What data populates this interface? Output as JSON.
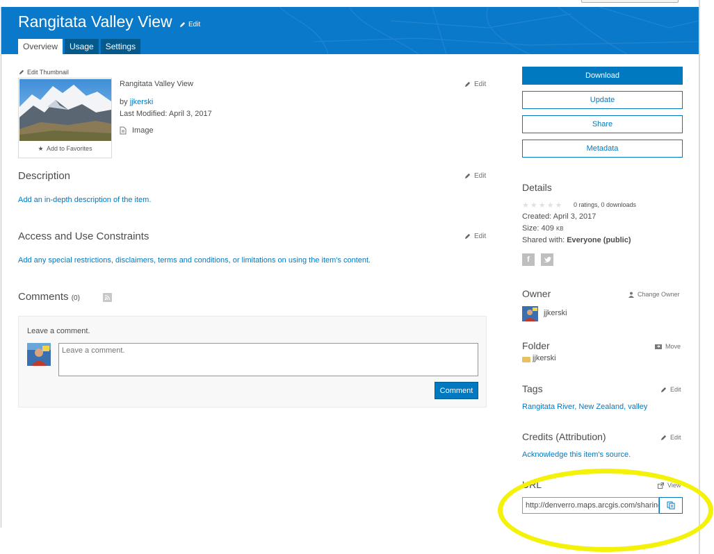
{
  "header": {
    "title": "Rangitata Valley View",
    "edit_label": "Edit",
    "tabs": [
      "Overview",
      "Usage",
      "Settings"
    ],
    "active_tab": "Overview",
    "color": "#0b79c9"
  },
  "item": {
    "edit_thumbnail": "Edit Thumbnail",
    "add_to_favorites": "Add to Favorites",
    "title": "Rangitata Valley View",
    "by_prefix": "by",
    "owner": "jjkerski",
    "last_modified": "Last Modified: April 3, 2017",
    "type": "Image",
    "edit_label": "Edit"
  },
  "description": {
    "heading": "Description",
    "edit_label": "Edit",
    "link": "Add an in-depth description of the item."
  },
  "access": {
    "heading": "Access and Use Constraints",
    "edit_label": "Edit",
    "link": "Add any special restrictions, disclaimers, terms and conditions, or limitations on using the item's content."
  },
  "comments": {
    "heading": "Comments",
    "count": "(0)",
    "leave_label": "Leave a comment.",
    "placeholder": "Leave a comment.",
    "button": "Comment"
  },
  "actions": {
    "download": "Download",
    "update": "Update",
    "share": "Share",
    "metadata": "Metadata"
  },
  "details": {
    "heading": "Details",
    "rating_stars": 0,
    "ratings": "0 ratings, 0 downloads",
    "created": "Created: April 3, 2017",
    "size_label": "Size: 409",
    "size_unit": "KB",
    "shared_label": "Shared with:",
    "shared_value": "Everyone (public)",
    "social": [
      "facebook-icon",
      "twitter-icon"
    ]
  },
  "owner": {
    "heading": "Owner",
    "change_label": "Change Owner",
    "name": "jjkerski"
  },
  "folder": {
    "heading": "Folder",
    "move_label": "Move",
    "name": "jjkerski"
  },
  "tags": {
    "heading": "Tags",
    "edit_label": "Edit",
    "value": "Rangitata River, New Zealand, valley"
  },
  "credits": {
    "heading": "Credits (Attribution)",
    "edit_label": "Edit",
    "link": "Acknowledge this item's source."
  },
  "url": {
    "heading": "URL",
    "view_label": "View",
    "value": "http://denverro.maps.arcgis.com/sharing/rest/content/items"
  },
  "annotation": {
    "highlight_color": "#f5f20a"
  }
}
